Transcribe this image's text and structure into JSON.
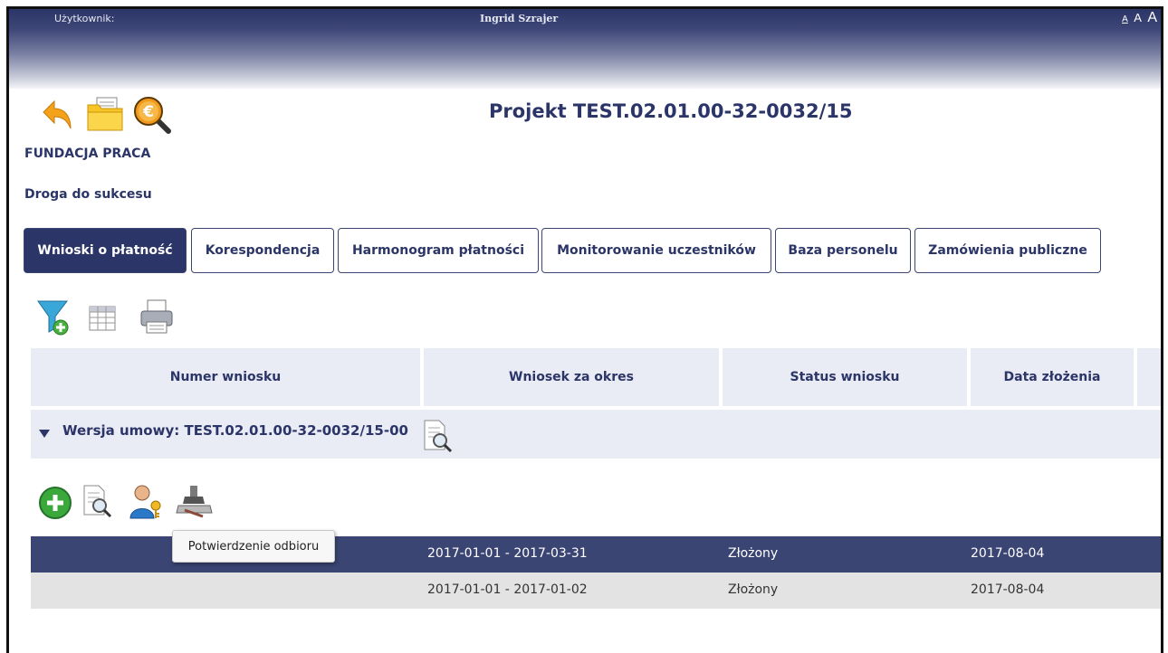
{
  "topbar": {
    "user_label": "Użytkownik:",
    "user_name": "Ingrid Szrajer",
    "font_small": "A",
    "font_medium": "A",
    "font_large": "A"
  },
  "project": {
    "title": "Projekt TEST.02.01.00-32-0032/15",
    "organization": "FUNDACJA PRACA",
    "name": "Droga do sukcesu"
  },
  "tabs": [
    {
      "label": "Wnioski o płatność",
      "active": true
    },
    {
      "label": "Korespondencja"
    },
    {
      "label": "Harmonogram płatności"
    },
    {
      "label": "Monitorowanie uczestników"
    },
    {
      "label": "Baza personelu"
    },
    {
      "label": "Zamówienia publiczne"
    }
  ],
  "table": {
    "columns": [
      "Numer wniosku",
      "Wniosek za okres",
      "Status wniosku",
      "Data złożenia"
    ],
    "version_label": "Wersja umowy: TEST.02.01.00-32-0032/15-00",
    "rows": [
      {
        "number": "",
        "period": "2017-01-01 - 2017-03-31",
        "status": "Złożony",
        "date": "2017-08-04"
      },
      {
        "number": "",
        "period": "2017-01-01 - 2017-01-02",
        "status": "Złożony",
        "date": "2017-08-04"
      }
    ]
  },
  "tooltip": {
    "text": "Potwierdzenie odbioru"
  },
  "icons": {
    "back": "back-arrow-icon",
    "folder": "folder-icon",
    "finance": "euro-search-icon",
    "filter": "filter-add-icon",
    "table": "table-columns-icon",
    "print": "printer-icon",
    "add": "add-icon",
    "preview": "document-preview-icon",
    "users": "user-key-icon",
    "stamp": "stamp-icon"
  }
}
